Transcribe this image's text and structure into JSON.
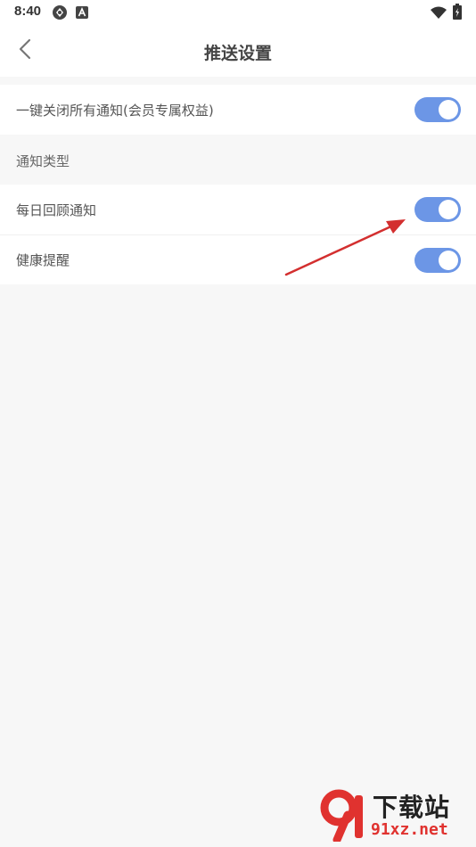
{
  "status_bar": {
    "time": "8:40"
  },
  "header": {
    "title": "推送设置"
  },
  "settings": {
    "all_notifications": {
      "label": "一键关闭所有通知(会员专属权益)",
      "enabled": true
    },
    "section_title": "通知类型",
    "items": [
      {
        "label": "每日回顾通知",
        "enabled": true
      },
      {
        "label": "健康提醒",
        "enabled": true
      }
    ]
  },
  "colors": {
    "toggle_on": "#6c96e6",
    "annotation_arrow": "#d32f2f"
  },
  "watermark": {
    "top_text": "下载站",
    "bottom_text": "91xz.net"
  }
}
